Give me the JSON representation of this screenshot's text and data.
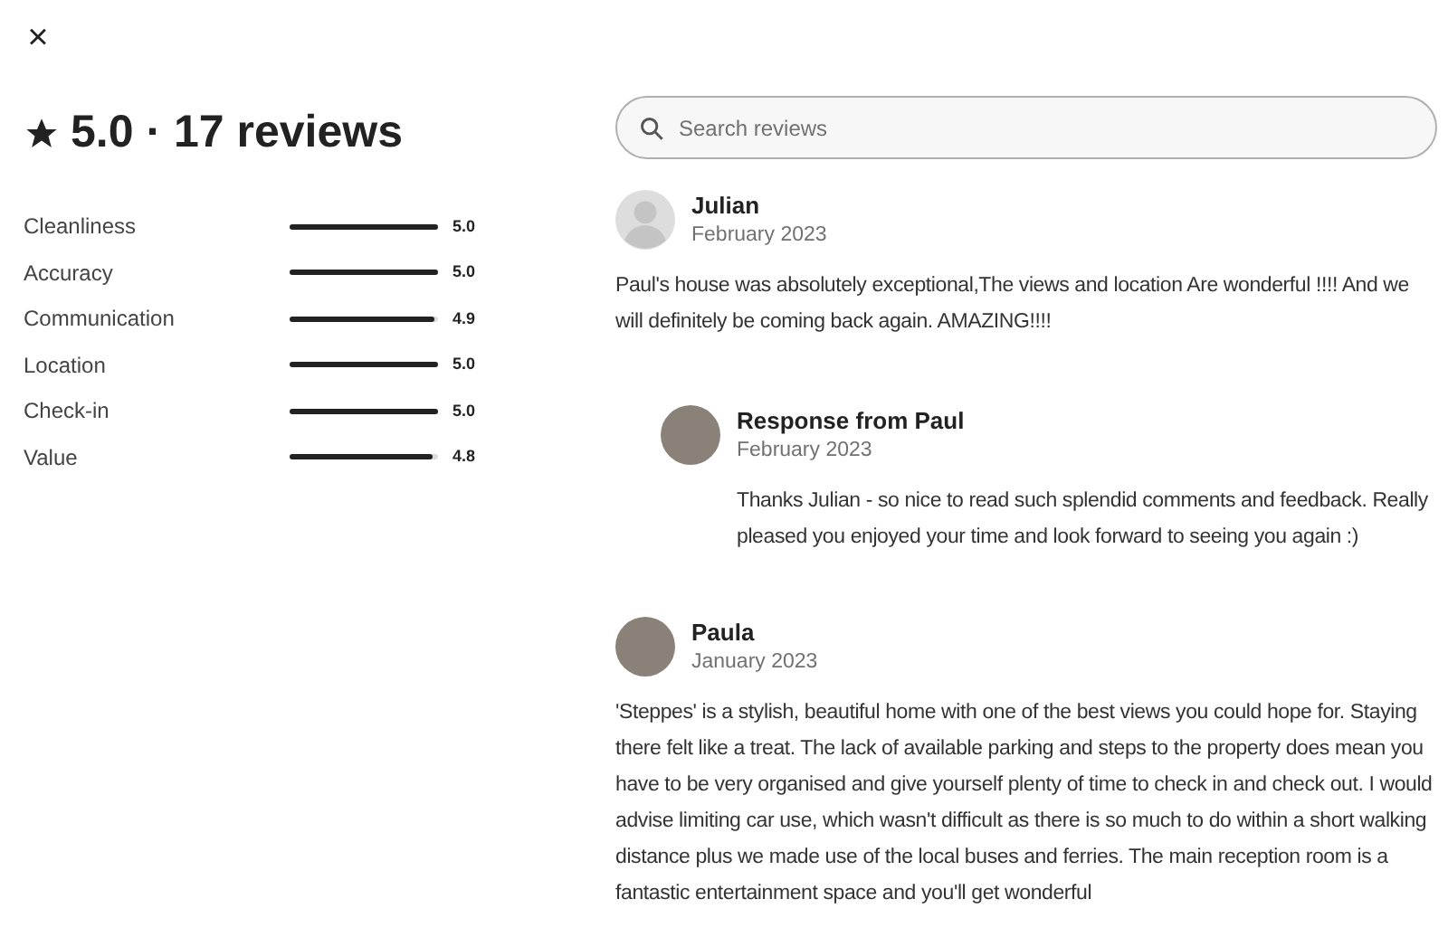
{
  "close_label": "×",
  "summary": {
    "rating": "5.0",
    "separator": "·",
    "count": "17 reviews"
  },
  "categories": [
    {
      "name": "Cleanliness",
      "level": 1,
      "score": "5.0"
    },
    {
      "name": "Accuracy",
      "level": 1,
      "score": "5.0"
    },
    {
      "name": "Communication",
      "level": 0.98,
      "score": "4.9"
    },
    {
      "name": "Location",
      "level": 1,
      "score": "5.0"
    },
    {
      "name": "Check-in",
      "level": 1,
      "score": "5.0"
    },
    {
      "name": "Value",
      "level": 0.96,
      "score": "4.8"
    }
  ],
  "search": {
    "placeholder": "Search reviews"
  },
  "reviews": [
    {
      "kind": "review",
      "has_photo": false,
      "name": "Julian",
      "date": "February 2023",
      "text": "Paul's house was absolutely exceptional,The views and location Are wonderful !!!! And we will definitely be coming back again. AMAZING!!!!"
    },
    {
      "kind": "response",
      "has_photo": true,
      "name": "Response from Paul",
      "date": "February 2023",
      "text": "Thanks Julian - so nice to read such splendid comments and feedback. Really pleased you enjoyed your time and look forward to seeing you again :)"
    },
    {
      "kind": "review",
      "has_photo": true,
      "name": "Paula",
      "date": "January 2023",
      "text": "'Steppes' is a stylish, beautiful home with one of the best views you could hope for. Staying there felt like a treat. The lack of available parking and steps to the property does mean you have to be very organised and give yourself plenty of time to check in and check out. I would advise limiting car use, which wasn't difficult as there is so much to do within a short walking distance plus we made use of the local buses and ferries. The main reception room is a fantastic entertainment space and you'll get wonderful"
    }
  ]
}
